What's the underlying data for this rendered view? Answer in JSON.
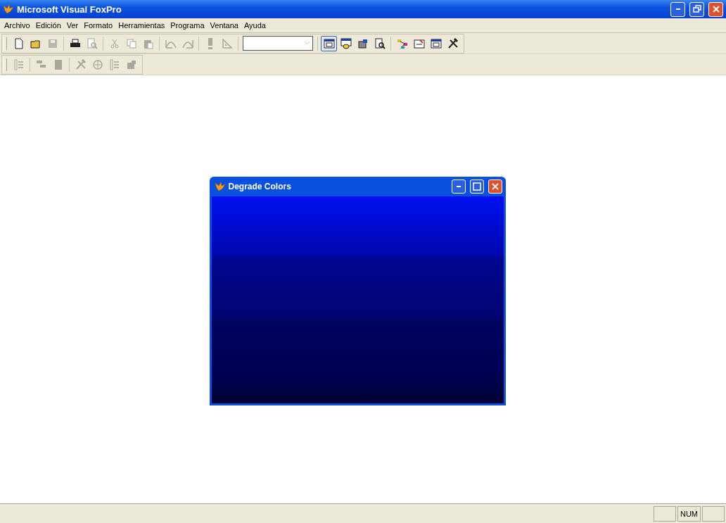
{
  "window": {
    "title": "Microsoft Visual FoxPro"
  },
  "menu": [
    {
      "label": "Archivo"
    },
    {
      "label": "Edición"
    },
    {
      "label": "Ver"
    },
    {
      "label": "Formato"
    },
    {
      "label": "Herramientas"
    },
    {
      "label": "Programa"
    },
    {
      "label": "Ventana"
    },
    {
      "label": "Ayuda"
    }
  ],
  "toolbar_standard": {
    "groups": [
      [
        {
          "kind": "document",
          "disabled": false,
          "selected": false
        },
        {
          "kind": "folder",
          "disabled": false,
          "selected": false
        },
        {
          "kind": "disk",
          "disabled": true,
          "selected": false
        }
      ],
      [
        {
          "kind": "printer",
          "disabled": false,
          "selected": false
        },
        {
          "kind": "magnifier",
          "disabled": true,
          "selected": false
        }
      ],
      [
        {
          "kind": "scissors",
          "disabled": true,
          "selected": false
        },
        {
          "kind": "copy",
          "disabled": true,
          "selected": false
        },
        {
          "kind": "clipboard",
          "disabled": true,
          "selected": false
        }
      ],
      [
        {
          "kind": "undo",
          "disabled": true,
          "selected": false
        },
        {
          "kind": "redo",
          "disabled": true,
          "selected": false
        }
      ],
      [
        {
          "kind": "exclamation",
          "disabled": true,
          "selected": false
        },
        {
          "kind": "set-square",
          "disabled": true,
          "selected": false
        }
      ],
      [
        {
          "kind": "combo",
          "disabled": true
        }
      ],
      [
        {
          "kind": "window",
          "disabled": false,
          "selected": true
        },
        {
          "kind": "database",
          "disabled": false,
          "selected": false
        },
        {
          "kind": "box",
          "disabled": false,
          "selected": false
        },
        {
          "kind": "magnifier",
          "disabled": false,
          "selected": false
        }
      ],
      [
        {
          "kind": "diagram",
          "disabled": false,
          "selected": false
        },
        {
          "kind": "form",
          "disabled": false,
          "selected": false
        },
        {
          "kind": "window",
          "disabled": false,
          "selected": false
        },
        {
          "kind": "tools",
          "disabled": false,
          "selected": false
        }
      ]
    ]
  },
  "toolbar_layout": {
    "groups": [
      [
        {
          "kind": "list",
          "disabled": true,
          "selected": false
        }
      ],
      [
        {
          "kind": "diagram",
          "disabled": true,
          "selected": false
        },
        {
          "kind": "document",
          "disabled": true,
          "selected": false
        }
      ],
      [
        {
          "kind": "tools",
          "disabled": true,
          "selected": false
        },
        {
          "kind": "globe",
          "disabled": true,
          "selected": false
        },
        {
          "kind": "list",
          "disabled": true,
          "selected": false
        },
        {
          "kind": "box",
          "disabled": true,
          "selected": false
        }
      ]
    ]
  },
  "child_window": {
    "title": "Degrade Colors"
  },
  "status_bar": {
    "indicator": "NUM"
  }
}
